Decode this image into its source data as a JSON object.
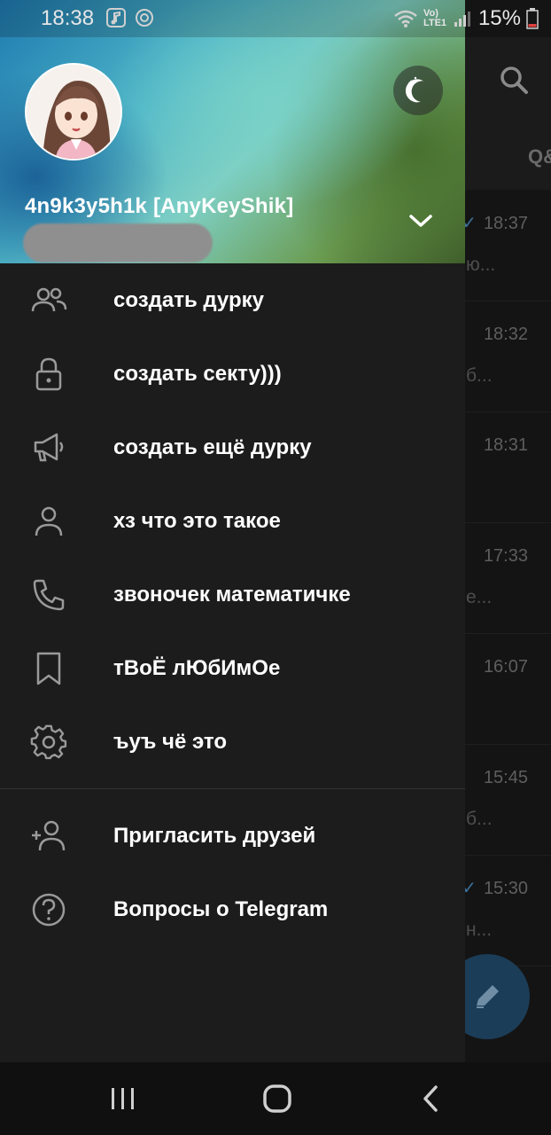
{
  "status_bar": {
    "time": "18:38",
    "network": "Vo) LTE1",
    "battery": "15%"
  },
  "drawer": {
    "user_name": "4n9k3y5h1k [AnyKeyShik]",
    "menu_items": [
      {
        "icon": "group-icon",
        "label": "создать дурку"
      },
      {
        "icon": "lock-icon",
        "label": "создать секту)))"
      },
      {
        "icon": "megaphone-icon",
        "label": "создать ещё дурку"
      },
      {
        "icon": "person-icon",
        "label": "хз что это такое"
      },
      {
        "icon": "phone-icon",
        "label": "звоночек математичке"
      },
      {
        "icon": "bookmark-icon",
        "label": "тВоЁ лЮбИмОе"
      },
      {
        "icon": "settings-icon",
        "label": "ъуъ чё это"
      }
    ],
    "secondary_items": [
      {
        "icon": "add-person-icon",
        "label": "Пригласить друзей"
      },
      {
        "icon": "help-icon",
        "label": "Вопросы о Telegram"
      }
    ]
  },
  "background_chats": {
    "tab_partial": "Q&",
    "rows": [
      {
        "time": "18:37",
        "snippet": "ю...",
        "read": true
      },
      {
        "time": "18:32",
        "snippet": "б...",
        "read": false
      },
      {
        "time": "18:31",
        "snippet": "",
        "read": false
      },
      {
        "time": "17:33",
        "snippet": "е...",
        "read": false
      },
      {
        "time": "16:07",
        "snippet": "",
        "read": false
      },
      {
        "time": "15:45",
        "snippet": "б...",
        "read": false
      },
      {
        "time": "15:30",
        "snippet": "н...",
        "read": true
      }
    ]
  },
  "colors": {
    "drawer_bg": "#1c1c1c",
    "text_primary": "#ffffff",
    "icon_color": "#9a9a9a",
    "fab": "#1c3d58"
  }
}
